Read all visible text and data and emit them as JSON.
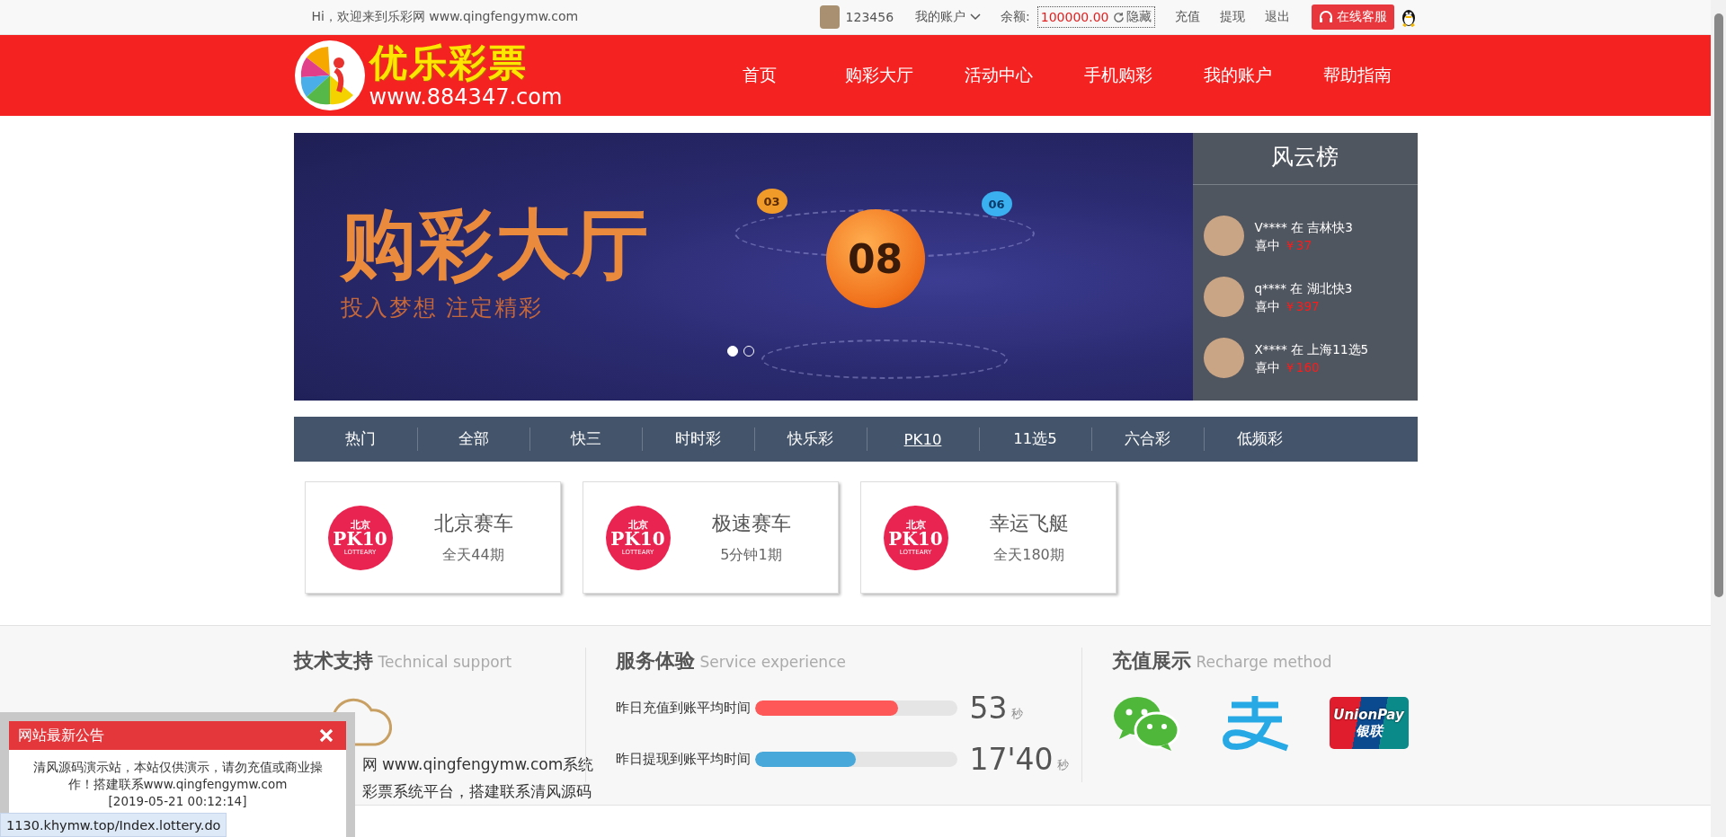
{
  "top_bar": {
    "greeting": "Hi，欢迎来到乐彩网 www.qingfengymw.com",
    "username": "123456",
    "account_menu": "我的账户",
    "balance_label": "余额:",
    "balance": "100000.00",
    "hide_button": "隐藏",
    "links": [
      "充值",
      "提现",
      "退出"
    ],
    "service_button": "在线客服"
  },
  "header": {
    "logo": {
      "name": "优乐彩票",
      "url": "www.884347.com"
    },
    "nav": [
      "首页",
      "购彩大厅",
      "活动中心",
      "手机购彩",
      "我的账户",
      "帮助指南"
    ]
  },
  "banner": {
    "title": "购彩大厅",
    "subtitle": "投入梦想  注定精彩",
    "main_ball": "08",
    "balls": [
      "03",
      "06"
    ],
    "slides": [
      {
        "selected": true
      },
      {
        "selected": false
      }
    ]
  },
  "leaderboard": {
    "title": "风云榜",
    "entries": [
      {
        "user": "V****",
        "word": "在",
        "game": "吉林快3",
        "prize_label": "喜中",
        "amount": "￥37"
      },
      {
        "user": "q****",
        "word": "在",
        "game": "湖北快3",
        "prize_label": "喜中",
        "amount": "￥397"
      },
      {
        "user": "X****",
        "word": "在",
        "game": "上海11选5",
        "prize_label": "喜中",
        "amount": "￥160"
      }
    ]
  },
  "categories": [
    {
      "label": "热门",
      "selected": false
    },
    {
      "label": "全部",
      "selected": false
    },
    {
      "label": "快三",
      "selected": false
    },
    {
      "label": "时时彩",
      "selected": false
    },
    {
      "label": "快乐彩",
      "selected": false
    },
    {
      "label": "PK10",
      "selected": true
    },
    {
      "label": "11选5",
      "selected": false
    },
    {
      "label": "六合彩",
      "selected": false
    },
    {
      "label": "低频彩",
      "selected": false
    }
  ],
  "games": [
    {
      "name": "北京赛车",
      "period": "全天44期",
      "logo": {
        "top": "北京",
        "main": "PK10",
        "sub": "LOTTEARY"
      }
    },
    {
      "name": "极速赛车",
      "period": "5分钟1期",
      "logo": {
        "top": "北京",
        "main": "PK10",
        "sub": "LOTTEARY"
      }
    },
    {
      "name": "幸运飞艇",
      "period": "全天180期",
      "logo": {
        "top": "北京",
        "main": "PK10",
        "sub": "LOTTEARY"
      }
    }
  ],
  "footer": {
    "tech": {
      "title": "技术支持",
      "subtitle": "Technical support",
      "lines": [
        "网 www.qingfengymw.com系统",
        "彩票系统平台，搭建联系清风源码"
      ]
    },
    "service": {
      "title": "服务体验",
      "subtitle": "Service experience",
      "metrics": [
        {
          "label": "昨日充值到账平均时间",
          "level": 0.71,
          "color": "#ff5858",
          "value": "53",
          "unit": "秒"
        },
        {
          "label": "昨日提现到账平均时间",
          "level": 0.5,
          "color": "#48a8d9",
          "value": "17'40",
          "unit": "秒"
        }
      ]
    },
    "recharge": {
      "title": "充值展示",
      "subtitle": "Recharge method",
      "methods": [
        {
          "kind": "wechat"
        },
        {
          "kind": "alipay"
        },
        {
          "kind": "unionpay",
          "text": "UnionPay",
          "text2": "银联"
        }
      ]
    }
  },
  "notice": {
    "title": "网站最新公告",
    "body": "清风源码演示站，本站仅供演示，请勿充值或商业操作！搭建联系www.qingfengymw.com",
    "date": "[2019-05-21 00:12:14]"
  },
  "status_url": "1130.khymw.top/Index.lottery.do"
}
